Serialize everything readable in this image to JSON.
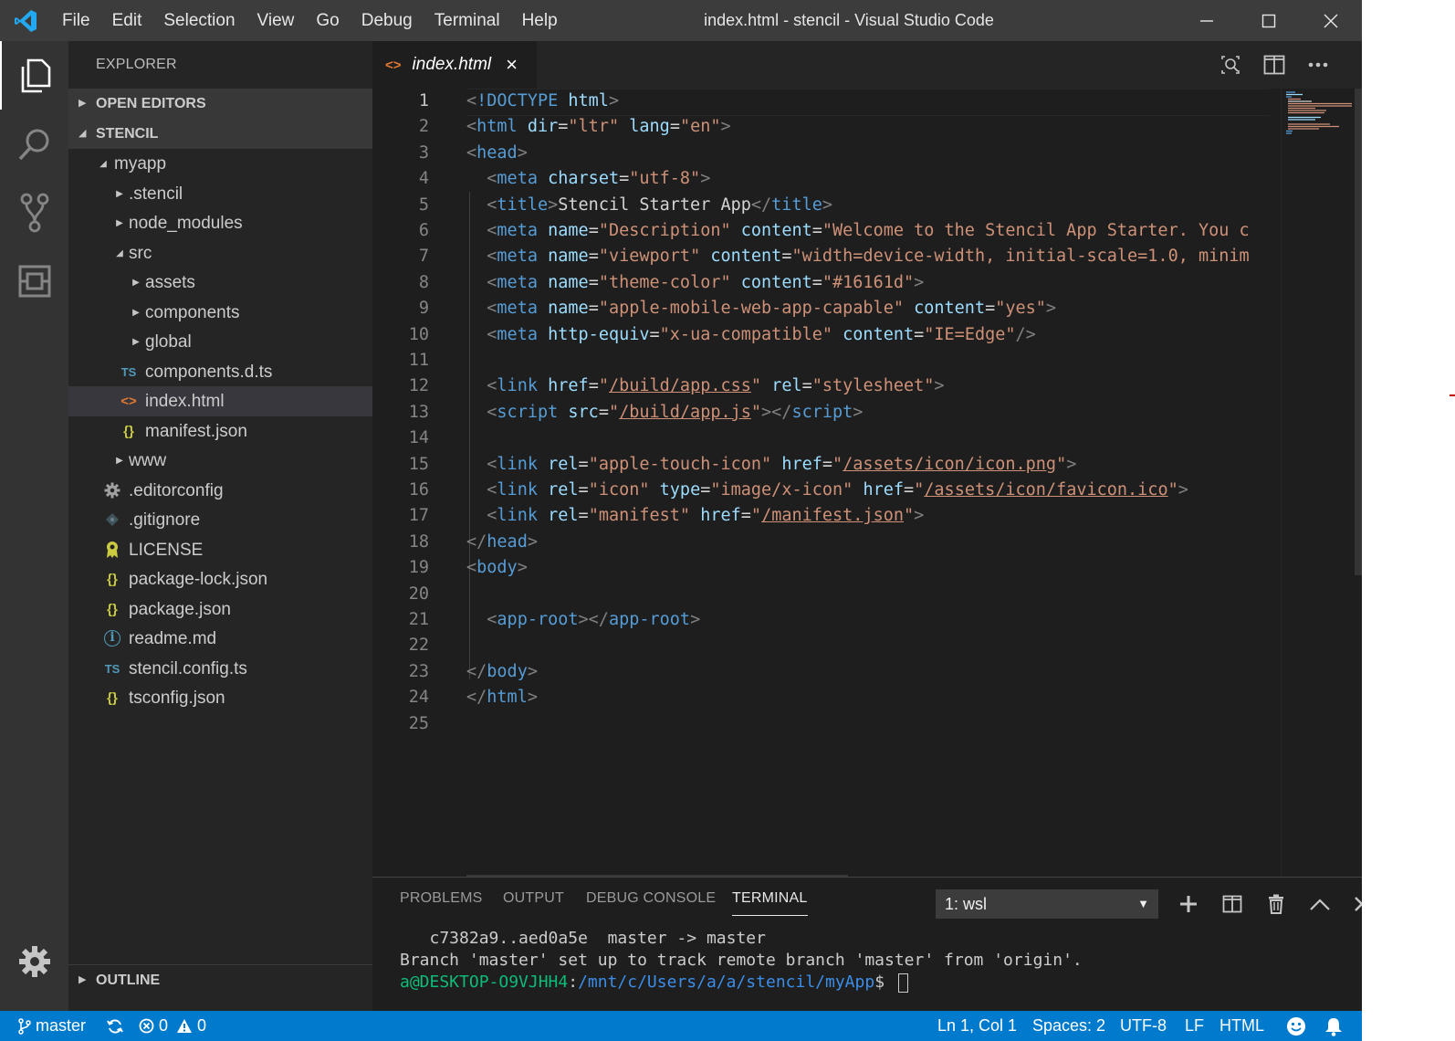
{
  "window": {
    "title": "index.html - stencil - Visual Studio Code",
    "menu": [
      "File",
      "Edit",
      "Selection",
      "View",
      "Go",
      "Debug",
      "Terminal",
      "Help"
    ]
  },
  "sidebar": {
    "title": "EXPLORER",
    "sections": {
      "open_editors": "OPEN EDITORS",
      "project": "STENCIL",
      "outline": "OUTLINE"
    },
    "tree": [
      {
        "name": "myapp",
        "type": "folder",
        "expanded": true
      },
      {
        "name": ".stencil",
        "type": "folder"
      },
      {
        "name": "node_modules",
        "type": "folder"
      },
      {
        "name": "src",
        "type": "folder",
        "expanded": true
      },
      {
        "name": "assets",
        "type": "folder"
      },
      {
        "name": "components",
        "type": "folder"
      },
      {
        "name": "global",
        "type": "folder"
      },
      {
        "name": "components.d.ts",
        "type": "ts",
        "icon_text": "TS"
      },
      {
        "name": "index.html",
        "type": "html",
        "icon_text": "<>",
        "selected": true
      },
      {
        "name": "manifest.json",
        "type": "json",
        "icon_text": "{}"
      },
      {
        "name": "www",
        "type": "folder"
      },
      {
        "name": ".editorconfig",
        "type": "config",
        "icon": "gear-icon"
      },
      {
        "name": ".gitignore",
        "type": "git",
        "icon": "git-diamond-icon"
      },
      {
        "name": "LICENSE",
        "type": "license",
        "icon": "license-ribbon-icon"
      },
      {
        "name": "package-lock.json",
        "type": "json",
        "icon_text": "{}"
      },
      {
        "name": "package.json",
        "type": "json",
        "icon_text": "{}"
      },
      {
        "name": "readme.md",
        "type": "info",
        "icon_text": "i"
      },
      {
        "name": "stencil.config.ts",
        "type": "ts",
        "icon_text": "TS"
      },
      {
        "name": "tsconfig.json",
        "type": "json",
        "icon_text": "{}"
      }
    ]
  },
  "editor": {
    "tab": {
      "title": "index.html",
      "icon_text": "<>",
      "close": "×"
    },
    "current_line": 1,
    "lines": [
      [
        [
          "p",
          "<"
        ],
        [
          "t",
          "!DOCTYPE"
        ],
        [
          "x",
          " "
        ],
        [
          "a",
          "html"
        ],
        [
          "p",
          ">"
        ]
      ],
      [
        [
          "p",
          "<"
        ],
        [
          "t",
          "html"
        ],
        [
          "x",
          " "
        ],
        [
          "a",
          "dir"
        ],
        [
          "e",
          "="
        ],
        [
          "s",
          "\"ltr\""
        ],
        [
          "x",
          " "
        ],
        [
          "a",
          "lang"
        ],
        [
          "e",
          "="
        ],
        [
          "s",
          "\"en\""
        ],
        [
          "p",
          ">"
        ]
      ],
      [
        [
          "p",
          "<"
        ],
        [
          "t",
          "head"
        ],
        [
          "p",
          ">"
        ]
      ],
      [
        [
          "x",
          "  "
        ],
        [
          "p",
          "<"
        ],
        [
          "t",
          "meta"
        ],
        [
          "x",
          " "
        ],
        [
          "a",
          "charset"
        ],
        [
          "e",
          "="
        ],
        [
          "s",
          "\"utf-8\""
        ],
        [
          "p",
          ">"
        ]
      ],
      [
        [
          "x",
          "  "
        ],
        [
          "p",
          "<"
        ],
        [
          "t",
          "title"
        ],
        [
          "p",
          ">"
        ],
        [
          "x",
          "Stencil Starter App"
        ],
        [
          "p",
          "</"
        ],
        [
          "t",
          "title"
        ],
        [
          "p",
          ">"
        ]
      ],
      [
        [
          "x",
          "  "
        ],
        [
          "p",
          "<"
        ],
        [
          "t",
          "meta"
        ],
        [
          "x",
          " "
        ],
        [
          "a",
          "name"
        ],
        [
          "e",
          "="
        ],
        [
          "s",
          "\"Description\""
        ],
        [
          "x",
          " "
        ],
        [
          "a",
          "content"
        ],
        [
          "e",
          "="
        ],
        [
          "s",
          "\"Welcome to the Stencil App Starter. You c"
        ]
      ],
      [
        [
          "x",
          "  "
        ],
        [
          "p",
          "<"
        ],
        [
          "t",
          "meta"
        ],
        [
          "x",
          " "
        ],
        [
          "a",
          "name"
        ],
        [
          "e",
          "="
        ],
        [
          "s",
          "\"viewport\""
        ],
        [
          "x",
          " "
        ],
        [
          "a",
          "content"
        ],
        [
          "e",
          "="
        ],
        [
          "s",
          "\"width=device-width, initial-scale=1.0, minim"
        ]
      ],
      [
        [
          "x",
          "  "
        ],
        [
          "p",
          "<"
        ],
        [
          "t",
          "meta"
        ],
        [
          "x",
          " "
        ],
        [
          "a",
          "name"
        ],
        [
          "e",
          "="
        ],
        [
          "s",
          "\"theme-color\""
        ],
        [
          "x",
          " "
        ],
        [
          "a",
          "content"
        ],
        [
          "e",
          "="
        ],
        [
          "s",
          "\"#16161d\""
        ],
        [
          "p",
          ">"
        ]
      ],
      [
        [
          "x",
          "  "
        ],
        [
          "p",
          "<"
        ],
        [
          "t",
          "meta"
        ],
        [
          "x",
          " "
        ],
        [
          "a",
          "name"
        ],
        [
          "e",
          "="
        ],
        [
          "s",
          "\"apple-mobile-web-app-capable\""
        ],
        [
          "x",
          " "
        ],
        [
          "a",
          "content"
        ],
        [
          "e",
          "="
        ],
        [
          "s",
          "\"yes\""
        ],
        [
          "p",
          ">"
        ]
      ],
      [
        [
          "x",
          "  "
        ],
        [
          "p",
          "<"
        ],
        [
          "t",
          "meta"
        ],
        [
          "x",
          " "
        ],
        [
          "a",
          "http-equiv"
        ],
        [
          "e",
          "="
        ],
        [
          "s",
          "\"x-ua-compatible\""
        ],
        [
          "x",
          " "
        ],
        [
          "a",
          "content"
        ],
        [
          "e",
          "="
        ],
        [
          "s",
          "\"IE=Edge\""
        ],
        [
          "p",
          "/>"
        ]
      ],
      [],
      [
        [
          "x",
          "  "
        ],
        [
          "p",
          "<"
        ],
        [
          "t",
          "link"
        ],
        [
          "x",
          " "
        ],
        [
          "a",
          "href"
        ],
        [
          "e",
          "="
        ],
        [
          "s",
          "\""
        ],
        [
          "l",
          "/build/app.css"
        ],
        [
          "s",
          "\""
        ],
        [
          "x",
          " "
        ],
        [
          "a",
          "rel"
        ],
        [
          "e",
          "="
        ],
        [
          "s",
          "\"stylesheet\""
        ],
        [
          "p",
          ">"
        ]
      ],
      [
        [
          "x",
          "  "
        ],
        [
          "p",
          "<"
        ],
        [
          "t",
          "script"
        ],
        [
          "x",
          " "
        ],
        [
          "a",
          "src"
        ],
        [
          "e",
          "="
        ],
        [
          "s",
          "\""
        ],
        [
          "l",
          "/build/app.js"
        ],
        [
          "s",
          "\""
        ],
        [
          "p",
          "></"
        ],
        [
          "t",
          "script"
        ],
        [
          "p",
          ">"
        ]
      ],
      [],
      [
        [
          "x",
          "  "
        ],
        [
          "p",
          "<"
        ],
        [
          "t",
          "link"
        ],
        [
          "x",
          " "
        ],
        [
          "a",
          "rel"
        ],
        [
          "e",
          "="
        ],
        [
          "s",
          "\"apple-touch-icon\""
        ],
        [
          "x",
          " "
        ],
        [
          "a",
          "href"
        ],
        [
          "e",
          "="
        ],
        [
          "s",
          "\""
        ],
        [
          "l",
          "/assets/icon/icon.png"
        ],
        [
          "s",
          "\""
        ],
        [
          "p",
          ">"
        ]
      ],
      [
        [
          "x",
          "  "
        ],
        [
          "p",
          "<"
        ],
        [
          "t",
          "link"
        ],
        [
          "x",
          " "
        ],
        [
          "a",
          "rel"
        ],
        [
          "e",
          "="
        ],
        [
          "s",
          "\"icon\""
        ],
        [
          "x",
          " "
        ],
        [
          "a",
          "type"
        ],
        [
          "e",
          "="
        ],
        [
          "s",
          "\"image/x-icon\""
        ],
        [
          "x",
          " "
        ],
        [
          "a",
          "href"
        ],
        [
          "e",
          "="
        ],
        [
          "s",
          "\""
        ],
        [
          "l",
          "/assets/icon/favicon.ico"
        ],
        [
          "s",
          "\""
        ],
        [
          "p",
          ">"
        ]
      ],
      [
        [
          "x",
          "  "
        ],
        [
          "p",
          "<"
        ],
        [
          "t",
          "link"
        ],
        [
          "x",
          " "
        ],
        [
          "a",
          "rel"
        ],
        [
          "e",
          "="
        ],
        [
          "s",
          "\"manifest\""
        ],
        [
          "x",
          " "
        ],
        [
          "a",
          "href"
        ],
        [
          "e",
          "="
        ],
        [
          "s",
          "\""
        ],
        [
          "l",
          "/manifest.json"
        ],
        [
          "s",
          "\""
        ],
        [
          "p",
          ">"
        ]
      ],
      [
        [
          "p",
          "</"
        ],
        [
          "t",
          "head"
        ],
        [
          "p",
          ">"
        ]
      ],
      [
        [
          "p",
          "<"
        ],
        [
          "t",
          "body"
        ],
        [
          "p",
          ">"
        ]
      ],
      [],
      [
        [
          "x",
          "  "
        ],
        [
          "p",
          "<"
        ],
        [
          "t",
          "app-root"
        ],
        [
          "p",
          "></"
        ],
        [
          "t",
          "app-root"
        ],
        [
          "p",
          ">"
        ]
      ],
      [],
      [
        [
          "p",
          "</"
        ],
        [
          "t",
          "body"
        ],
        [
          "p",
          ">"
        ]
      ],
      [
        [
          "p",
          "</"
        ],
        [
          "t",
          "html"
        ],
        [
          "p",
          ">"
        ]
      ],
      []
    ]
  },
  "panel": {
    "tabs": [
      "PROBLEMS",
      "OUTPUT",
      "DEBUG CONSOLE",
      "TERMINAL"
    ],
    "active_tab": "TERMINAL",
    "terminal_select": "1: wsl",
    "terminal_lines": [
      "   c7382a9..aed0a5e  master -> master",
      "Branch 'master' set up to track remote branch 'master' from 'origin'."
    ],
    "prompt": {
      "user": "a@DESKTOP-O9VJHH4",
      "sep": ":",
      "path": "/mnt/c/Users/a/a/stencil/myApp",
      "suffix": "$ "
    }
  },
  "statusbar": {
    "branch": "master",
    "errors": "0",
    "warnings": "0",
    "position": "Ln 1, Col 1",
    "spaces": "Spaces: 2",
    "encoding": "UTF-8",
    "eol": "LF",
    "language": "HTML"
  },
  "colors": {
    "statusbar": "#007acc",
    "titlebar": "#3c3c3c",
    "activitybar": "#333333",
    "sidebar": "#252526",
    "editor": "#1e1e1e",
    "tag": "#569cd6",
    "attribute": "#9cdcfe",
    "string": "#ce9178",
    "json_icon": "#cbcb41",
    "html_icon": "#e37933",
    "ts_icon": "#519aba"
  }
}
